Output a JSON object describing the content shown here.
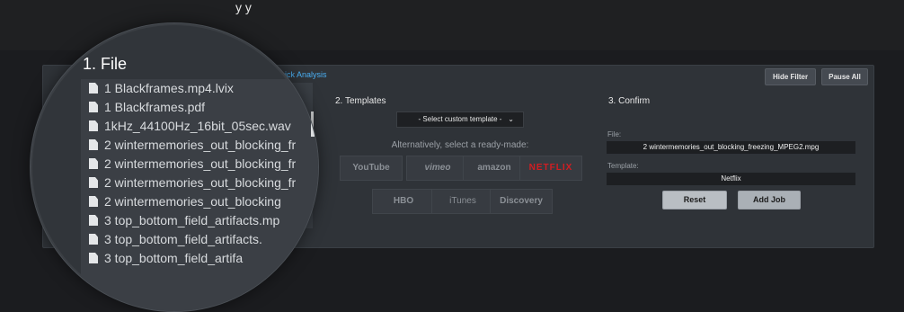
{
  "header": {
    "top_text": "y y"
  },
  "actions": {
    "quick_analysis": "Quick Analysis",
    "hide_filter": "Hide Filter",
    "pause_all": "Pause All"
  },
  "file_section": {
    "title": "1. File",
    "items": [
      "1 Blackframes.mp4.lvix",
      "1 Blackframes.pdf",
      "1kHz_44100Hz_16bit_05sec.wav",
      "2 wintermemories_out_blocking_fr",
      "2 wintermemories_out_blocking_fr",
      "2 wintermemories_out_blocking_fr",
      "2 wintermemories_out_blocking",
      "3 top_bottom_field_artifacts.mp",
      "3 top_bottom_field_artifacts.",
      "3 top_bottom_field_artifa"
    ]
  },
  "templates_section": {
    "title": "2. Templates",
    "select_placeholder": "- Select custom template -",
    "alt_text": "Alternatively, select a ready-made:",
    "logos": [
      "YouTube",
      "vimeo",
      "amazon",
      "NETFLIX",
      "HBO",
      "iTunes",
      "Discovery"
    ]
  },
  "confirm_section": {
    "title": "3. Confirm",
    "file_label": "File:",
    "file_value": "2 wintermemories_out_blocking_freezing_MPEG2.mpg",
    "template_label": "Template:",
    "template_value": "Netflix",
    "reset_label": "Reset",
    "add_job_label": "Add Job"
  },
  "colors": {
    "accent_link": "#4ab0f5",
    "netflix_red": "#d21d22"
  }
}
